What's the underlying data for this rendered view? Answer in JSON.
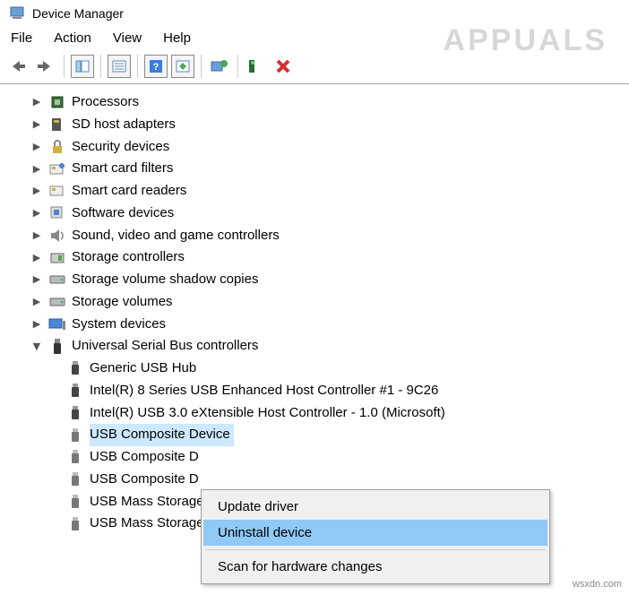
{
  "window": {
    "title": "Device Manager"
  },
  "menubar": {
    "file": "File",
    "action": "Action",
    "view": "View",
    "help": "Help"
  },
  "watermark": "APPUALS",
  "credit": "wsxdn.com",
  "tree": {
    "items": [
      {
        "label": "Processors",
        "expanded": false,
        "icon": "cpu"
      },
      {
        "label": "SD host adapters",
        "expanded": false,
        "icon": "sd"
      },
      {
        "label": "Security devices",
        "expanded": false,
        "icon": "lock"
      },
      {
        "label": "Smart card filters",
        "expanded": false,
        "icon": "card"
      },
      {
        "label": "Smart card readers",
        "expanded": false,
        "icon": "reader"
      },
      {
        "label": "Software devices",
        "expanded": false,
        "icon": "sw"
      },
      {
        "label": "Sound, video and game controllers",
        "expanded": false,
        "icon": "audio"
      },
      {
        "label": "Storage controllers",
        "expanded": false,
        "icon": "storage"
      },
      {
        "label": "Storage volume shadow copies",
        "expanded": false,
        "icon": "drive"
      },
      {
        "label": "Storage volumes",
        "expanded": false,
        "icon": "drive"
      },
      {
        "label": "System devices",
        "expanded": false,
        "icon": "pc"
      },
      {
        "label": "Universal Serial Bus controllers",
        "expanded": true,
        "icon": "usb",
        "children": [
          {
            "label": "Generic USB Hub",
            "selected": false
          },
          {
            "label": "Intel(R) 8 Series USB Enhanced Host Controller #1 - 9C26",
            "selected": false
          },
          {
            "label": "Intel(R) USB 3.0 eXtensible Host Controller - 1.0 (Microsoft)",
            "selected": false
          },
          {
            "label": "USB Composite Device",
            "selected": true
          },
          {
            "label": "USB Composite D",
            "selected": false
          },
          {
            "label": "USB Composite D",
            "selected": false
          },
          {
            "label": "USB Mass Storage",
            "selected": false
          },
          {
            "label": "USB Mass Storage",
            "selected": false
          }
        ]
      }
    ]
  },
  "context": {
    "update": "Update driver",
    "uninstall": "Uninstall device",
    "scan": "Scan for hardware changes"
  }
}
